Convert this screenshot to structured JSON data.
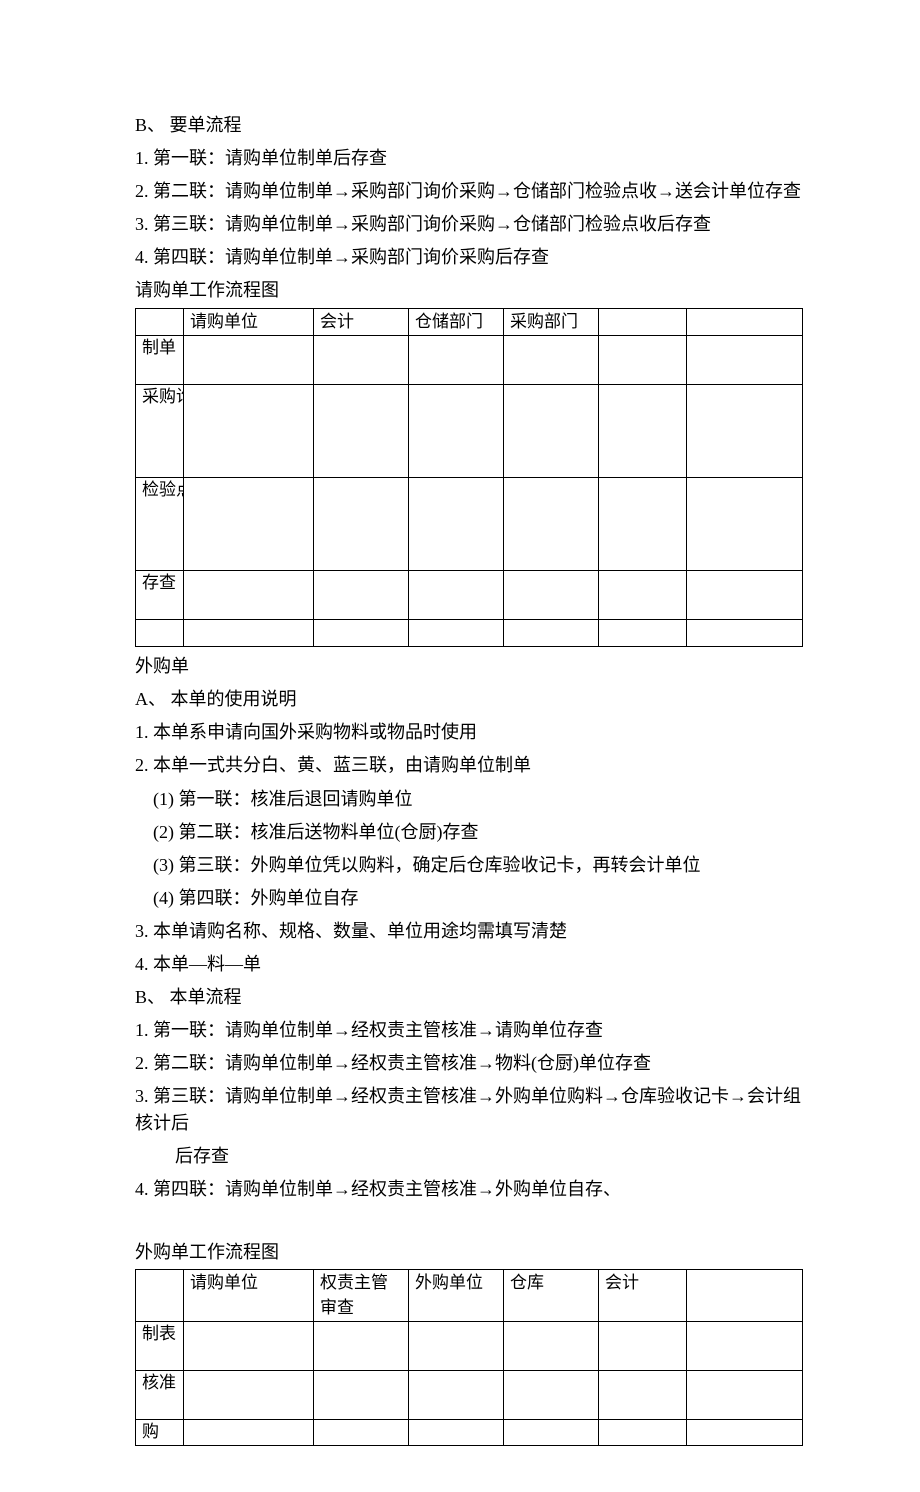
{
  "sectionB": {
    "heading": "B、 要单流程",
    "items": [
      "1. 第一联：请购单位制单后存查",
      "2. 第二联：请购单位制单→采购部门询价采购→仓储部门检验点收→送会计单位存查",
      "3. 第三联：请购单位制单→采购部门询价采购→仓储部门检验点收后存查",
      "4. 第四联：请购单位制单→采购部门询价采购后存查"
    ],
    "caption": "请购单工作流程图"
  },
  "table1": {
    "headers": [
      "",
      "请购单位",
      "会计",
      "仓储部门",
      "采购部门",
      "",
      ""
    ],
    "rows": [
      {
        "label": "制单"
      },
      {
        "label": "采购询价"
      },
      {
        "label": "检验点收"
      },
      {
        "label": "存查"
      },
      {
        "label": ""
      }
    ]
  },
  "waigou": {
    "title": "外购单",
    "headingA": "A、 本单的使用说明",
    "a_items": [
      "1. 本单系申请向国外采购物料或物品时使用",
      "2. 本单一式共分白、黄、蓝三联，由请购单位制单"
    ],
    "a_sub": [
      "(1) 第一联：核准后退回请购单位",
      "(2) 第二联：核准后送物料单位(仓厨)存查",
      "(3) 第三联：外购单位凭以购料，确定后仓库验收记卡，再转会计单位",
      "(4) 第四联：外购单位自存"
    ],
    "a_items2": [
      "3. 本单请购名称、规格、数量、单位用途均需填写清楚",
      "4. 本单—料—单"
    ],
    "headingB": "B、 本单流程",
    "b_items": [
      "1. 第一联：请购单位制单→经权责主管核准→请购单位存查",
      "2. 第二联：请购单位制单→经权责主管核准→物料(仓厨)单位存查",
      "3. 第三联：请购单位制单→经权责主管核准→外购单位购料→仓库验收记卡→会计组核计后",
      "后存查",
      "4. 第四联：请购单位制单→经权责主管核准→外购单位自存、"
    ],
    "caption": "外购单工作流程图"
  },
  "table2": {
    "headers": [
      "",
      "请购单位",
      "权责主管审查",
      "外购单位",
      "仓库",
      "会计",
      ""
    ],
    "rows": [
      {
        "label": "制表"
      },
      {
        "label": "核准"
      },
      {
        "label": "购"
      }
    ]
  }
}
